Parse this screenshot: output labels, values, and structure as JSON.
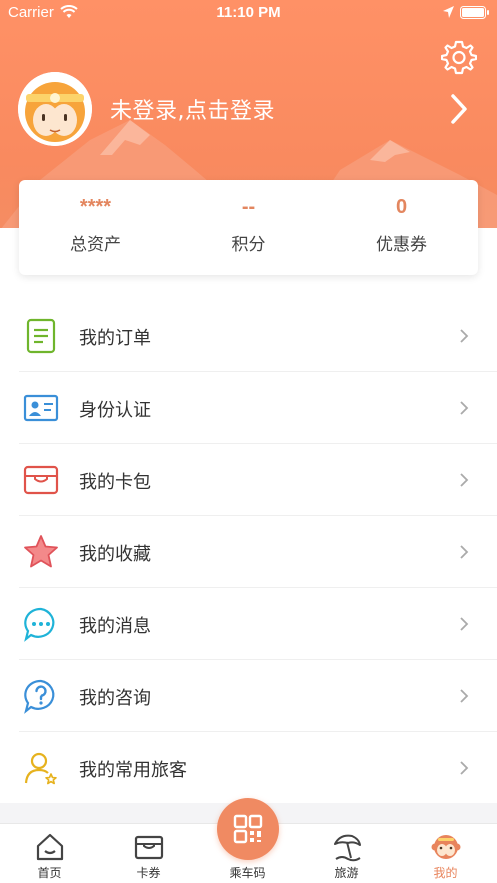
{
  "status_bar": {
    "carrier": "Carrier",
    "time": "11:10 PM"
  },
  "header": {
    "login_text": "未登录,点击登录"
  },
  "stats": [
    {
      "value": "****",
      "label": "总资产"
    },
    {
      "value": "--",
      "label": "积分"
    },
    {
      "value": "0",
      "label": "优惠券"
    }
  ],
  "menu": [
    {
      "label": "我的订单",
      "icon": "order-list-icon"
    },
    {
      "label": "身份认证",
      "icon": "id-card-icon"
    },
    {
      "label": "我的卡包",
      "icon": "card-wallet-icon"
    },
    {
      "label": "我的收藏",
      "icon": "star-icon"
    },
    {
      "label": "我的消息",
      "icon": "message-bubble-icon"
    },
    {
      "label": "我的咨询",
      "icon": "question-bubble-icon"
    },
    {
      "label": "我的常用旅客",
      "icon": "traveler-icon"
    }
  ],
  "tabs": [
    {
      "label": "首页",
      "icon": "home-icon"
    },
    {
      "label": "卡券",
      "icon": "ticket-icon"
    },
    {
      "label": "乘车码",
      "icon": "qr-code-icon"
    },
    {
      "label": "旅游",
      "icon": "beach-umbrella-icon"
    },
    {
      "label": "我的",
      "icon": "monkey-icon"
    }
  ],
  "colors": {
    "header": "#f98a5f",
    "accent": "#e8845c",
    "value": "#e3865f"
  }
}
